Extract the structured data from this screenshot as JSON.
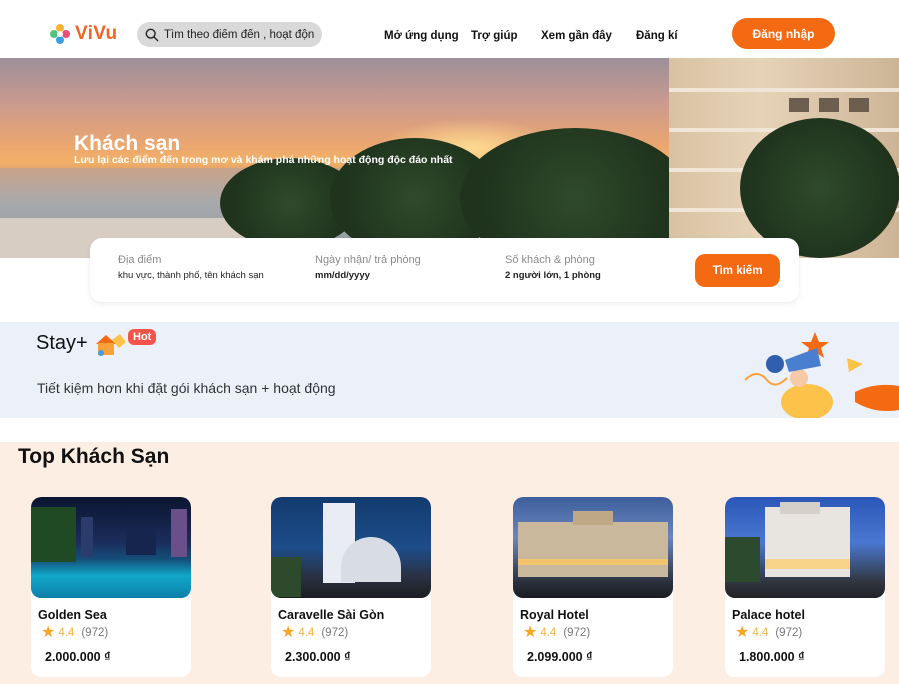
{
  "header": {
    "logo_text": "ViVu",
    "search_placeholder": "Tìm theo điểm đến , hoạt động",
    "nav": [
      "Mở ứng dụng",
      "Trợ giúp",
      "Xem gần đây",
      "Đăng kí"
    ],
    "login_label": "Đăng nhập",
    "accent_color": "#f46a12"
  },
  "hero": {
    "title": "Khách sạn",
    "subtitle": "Lưu lại các điểm đến trong mơ và khám phá những hoạt động độc đáo nhất"
  },
  "booking": {
    "location_label": "Địa điểm",
    "location_value": "khu vực, thành phố, tên khách sạn",
    "dates_label": "Ngày nhận/ trả phòng",
    "dates_value": "mm/dd/yyyy",
    "guests_label": "Số khách & phòng",
    "guests_value": "2 người lớn, 1 phòng",
    "search_label": "Tìm kiếm"
  },
  "promo": {
    "title": "Stay+",
    "badge": "Hot",
    "text": "Tiết kiệm hơn khi đặt gói khách sạn + hoạt động"
  },
  "hotels": {
    "title": "Top Khách Sạn",
    "items": [
      {
        "name": "Golden Sea",
        "rating": "4.4",
        "reviews": "(972)",
        "price": "2.000.000 ₫"
      },
      {
        "name": "Caravelle Sài Gòn",
        "rating": "4.4",
        "reviews": "(972)",
        "price": "2.300.000 ₫"
      },
      {
        "name": "Royal Hotel",
        "rating": "4.4",
        "reviews": "(972)",
        "price": "2.099.000 ₫"
      },
      {
        "name": "Palace hotel",
        "rating": "4.4",
        "reviews": "(972)",
        "price": "1.800.000 ₫"
      }
    ]
  }
}
